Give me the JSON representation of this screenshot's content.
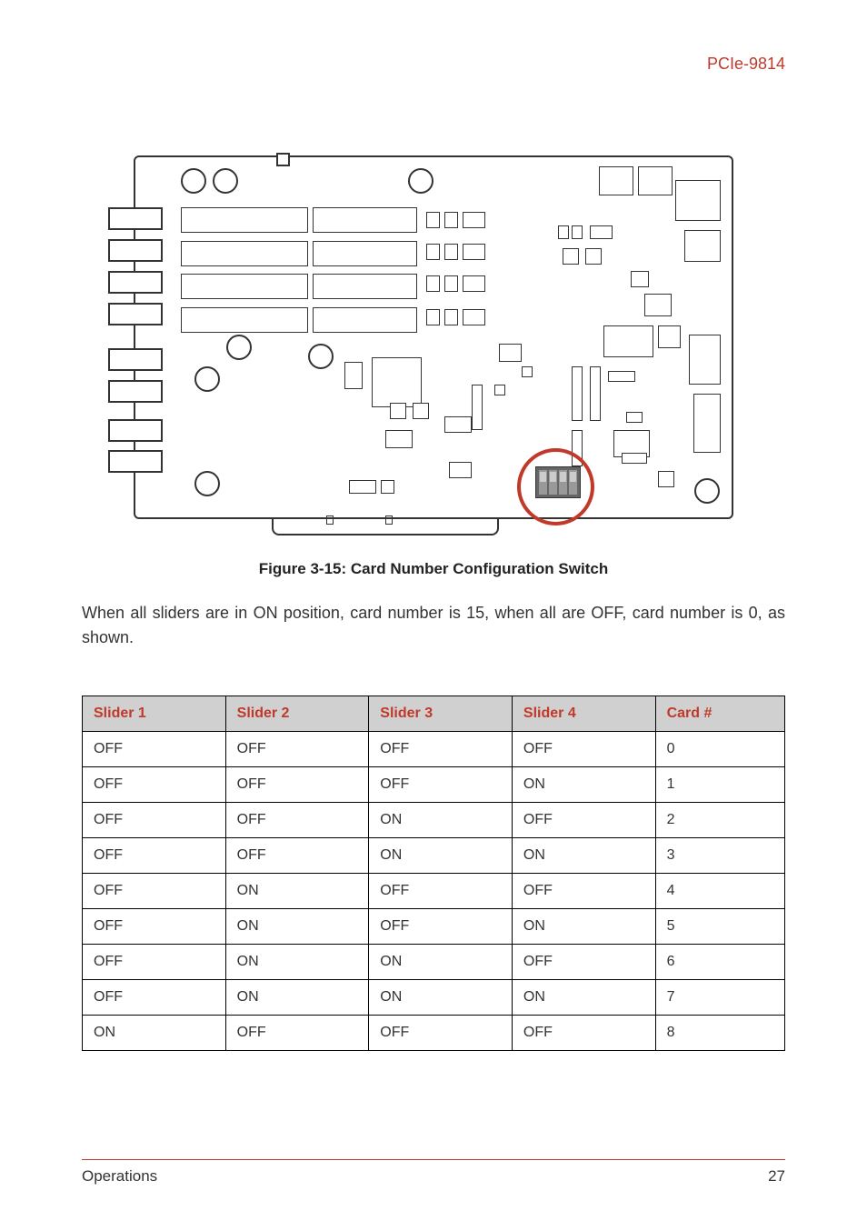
{
  "header": {
    "product": "PCIe-9814"
  },
  "figure": {
    "caption": "Figure 3-15: Card Number Configuration Switch"
  },
  "body": {
    "text": "When all sliders are in ON position, card number is 15, when all are OFF, card number is 0, as shown."
  },
  "table": {
    "headers": [
      "Slider 1",
      "Slider 2",
      "Slider 3",
      "Slider 4",
      "Card #"
    ],
    "rows": [
      [
        "OFF",
        "OFF",
        "OFF",
        "OFF",
        "0"
      ],
      [
        "OFF",
        "OFF",
        "OFF",
        "ON",
        "1"
      ],
      [
        "OFF",
        "OFF",
        "ON",
        "OFF",
        "2"
      ],
      [
        "OFF",
        "OFF",
        "ON",
        "ON",
        "3"
      ],
      [
        "OFF",
        "ON",
        "OFF",
        "OFF",
        "4"
      ],
      [
        "OFF",
        "ON",
        "OFF",
        "ON",
        "5"
      ],
      [
        "OFF",
        "ON",
        "ON",
        "OFF",
        "6"
      ],
      [
        "OFF",
        "ON",
        "ON",
        "ON",
        "7"
      ],
      [
        "ON",
        "OFF",
        "OFF",
        "OFF",
        "8"
      ]
    ]
  },
  "footer": {
    "section": "Operations",
    "page": "27"
  }
}
